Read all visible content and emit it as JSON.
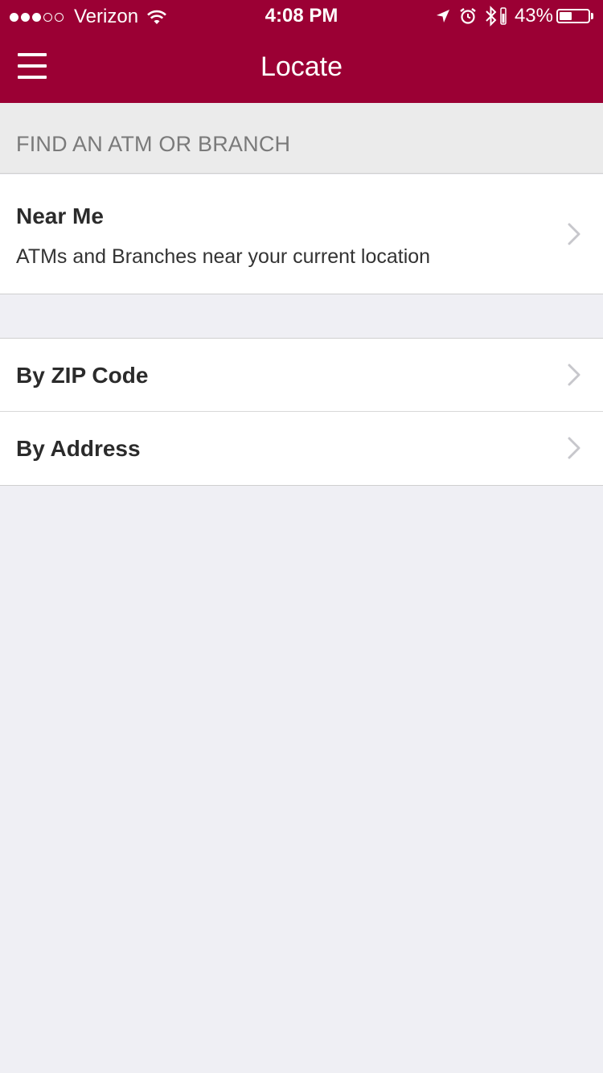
{
  "status_bar": {
    "signal_full": 3,
    "signal_total": 5,
    "carrier": "Verizon",
    "time": "4:08 PM",
    "battery_percent_label": "43%",
    "battery_level": 0.43
  },
  "nav": {
    "title": "Locate",
    "menu_icon": "hamburger-menu-icon"
  },
  "section": {
    "header": "FIND AN ATM OR BRANCH"
  },
  "rows": [
    {
      "title": "Near Me",
      "subtitle": "ATMs and Branches near your current location"
    },
    {
      "title": "By ZIP Code"
    },
    {
      "title": "By Address"
    }
  ],
  "colors": {
    "brand": "#9b0034",
    "background": "#efeff4",
    "section_header_bg": "#ebebeb",
    "section_header_text": "#7a7a7a",
    "chevron": "#c7c7cc"
  }
}
